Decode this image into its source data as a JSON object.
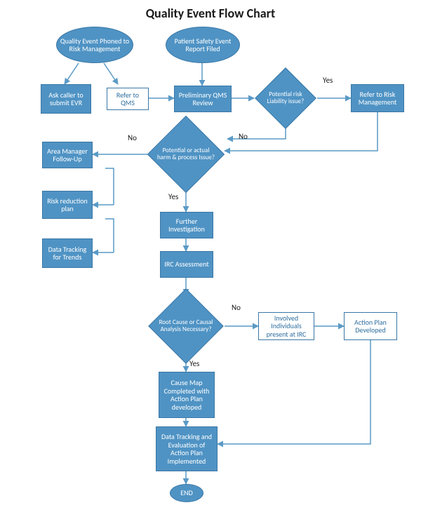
{
  "title": "Quality Event Flow Chart",
  "nodes": {
    "start1": "Quality Event Phoned to Risk Management",
    "start2": "Patient Safety Event Report Filed",
    "ask_evr": "Ask caller to submit EVR",
    "refer_qms": "Refer to QMS",
    "prelim": "Preliminary QMS Review",
    "liability": "Potential risk Liability issue?",
    "refer_risk": "Refer to Risk Management",
    "harm_issue": "Potential or actual harm & process Issue?",
    "area_followup": "Area Manager Follow-Up",
    "risk_reduction": "Risk reduction plan",
    "data_trends": "Data Tracking for Trends",
    "further_inv": "Further Investigation",
    "irc_assess": "IRC Assessment",
    "root_cause": "Root Cause or Causal Analysis Necessary?",
    "involved_irc": "Involved Individuals present at IRC",
    "action_plan": "Action Plan Developed",
    "cause_map": "Cause Map Completed with Action Plan developed",
    "data_eval": "Data Tracking and Evaluation of Action Plan Implemented",
    "end": "END"
  },
  "labels": {
    "yes": "Yes",
    "no": "No"
  },
  "chart_data": {
    "type": "flowchart",
    "title": "Quality Event Flow Chart",
    "nodes": [
      {
        "id": "start1",
        "type": "terminal",
        "label": "Quality Event Phoned to Risk Management"
      },
      {
        "id": "start2",
        "type": "terminal",
        "label": "Patient Safety Event Report Filed"
      },
      {
        "id": "ask_evr",
        "type": "process",
        "label": "Ask caller to submit EVR"
      },
      {
        "id": "refer_qms",
        "type": "process",
        "label": "Refer to QMS"
      },
      {
        "id": "prelim",
        "type": "process",
        "label": "Preliminary QMS Review"
      },
      {
        "id": "liability",
        "type": "decision",
        "label": "Potential risk Liability issue?"
      },
      {
        "id": "refer_risk",
        "type": "process",
        "label": "Refer to Risk Management"
      },
      {
        "id": "harm_issue",
        "type": "decision",
        "label": "Potential or actual harm & process Issue?"
      },
      {
        "id": "area_followup",
        "type": "process",
        "label": "Area Manager Follow-Up"
      },
      {
        "id": "risk_reduction",
        "type": "process",
        "label": "Risk reduction plan"
      },
      {
        "id": "data_trends",
        "type": "process",
        "label": "Data Tracking for Trends"
      },
      {
        "id": "further_inv",
        "type": "process",
        "label": "Further Investigation"
      },
      {
        "id": "irc_assess",
        "type": "process",
        "label": "IRC Assessment"
      },
      {
        "id": "root_cause",
        "type": "decision",
        "label": "Root Cause or Causal Analysis Necessary?"
      },
      {
        "id": "involved_irc",
        "type": "process",
        "label": "Involved Individuals present at IRC"
      },
      {
        "id": "action_plan",
        "type": "process",
        "label": "Action Plan Developed"
      },
      {
        "id": "cause_map",
        "type": "process",
        "label": "Cause Map Completed with Action Plan developed"
      },
      {
        "id": "data_eval",
        "type": "process",
        "label": "Data Tracking and Evaluation of Action Plan Implemented"
      },
      {
        "id": "end",
        "type": "terminal",
        "label": "END"
      }
    ],
    "edges": [
      {
        "from": "start1",
        "to": "ask_evr"
      },
      {
        "from": "start1",
        "to": "refer_qms"
      },
      {
        "from": "start2",
        "to": "prelim"
      },
      {
        "from": "refer_qms",
        "to": "prelim"
      },
      {
        "from": "prelim",
        "to": "liability"
      },
      {
        "from": "liability",
        "to": "refer_risk",
        "label": "Yes"
      },
      {
        "from": "liability",
        "to": "harm_issue",
        "label": "No"
      },
      {
        "from": "refer_risk",
        "to": "harm_issue"
      },
      {
        "from": "harm_issue",
        "to": "area_followup",
        "label": "No"
      },
      {
        "from": "area_followup",
        "to": "risk_reduction"
      },
      {
        "from": "risk_reduction",
        "to": "data_trends"
      },
      {
        "from": "harm_issue",
        "to": "further_inv",
        "label": "Yes"
      },
      {
        "from": "further_inv",
        "to": "irc_assess"
      },
      {
        "from": "irc_assess",
        "to": "root_cause"
      },
      {
        "from": "root_cause",
        "to": "involved_irc",
        "label": "No"
      },
      {
        "from": "involved_irc",
        "to": "action_plan"
      },
      {
        "from": "action_plan",
        "to": "data_eval"
      },
      {
        "from": "root_cause",
        "to": "cause_map",
        "label": "Yes"
      },
      {
        "from": "cause_map",
        "to": "data_eval"
      },
      {
        "from": "data_eval",
        "to": "end"
      }
    ]
  }
}
